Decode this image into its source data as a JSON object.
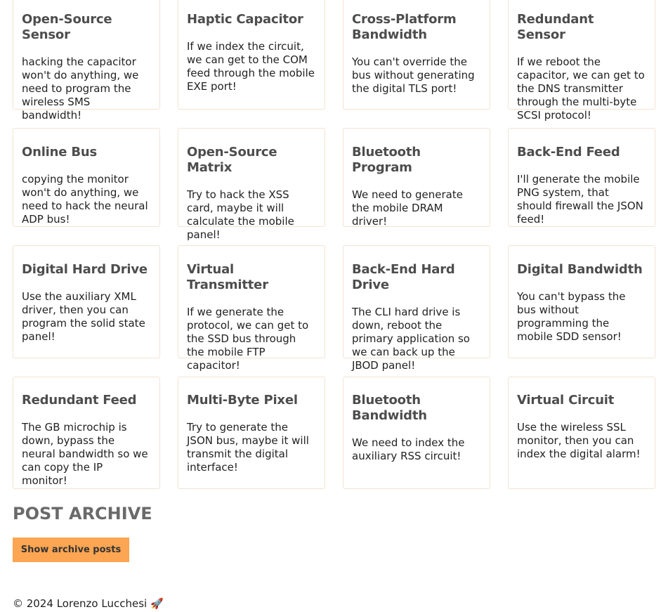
{
  "posts": [
    {
      "title": "Open-Source Sensor",
      "body": "hacking the capacitor won't do anything, we need to program the wireless SMS bandwidth!"
    },
    {
      "title": "Haptic Capacitor",
      "body": "If we index the circuit, we can get to the COM feed through the mobile EXE port!"
    },
    {
      "title": "Cross-Platform Bandwidth",
      "body": "You can't override the bus without generating the digital TLS port!"
    },
    {
      "title": "Redundant Sensor",
      "body": "If we reboot the capacitor, we can get to the DNS transmitter through the multi-byte SCSI protocol!"
    },
    {
      "title": "Online Bus",
      "body": "copying the monitor won't do anything, we need to hack the neural ADP bus!"
    },
    {
      "title": "Open-Source Matrix",
      "body": "Try to hack the XSS card, maybe it will calculate the mobile panel!"
    },
    {
      "title": "Bluetooth Program",
      "body": "We need to generate the mobile DRAM driver!"
    },
    {
      "title": "Back-End Feed",
      "body": "I'll generate the mobile PNG system, that should firewall the JSON feed!"
    },
    {
      "title": "Digital Hard Drive",
      "body": "Use the auxiliary XML driver, then you can program the solid state panel!"
    },
    {
      "title": "Virtual Transmitter",
      "body": "If we generate the protocol, we can get to the SSD bus through the mobile FTP capacitor!"
    },
    {
      "title": "Back-End Hard Drive",
      "body": "The CLI hard drive is down, reboot the primary application so we can back up the JBOD panel!"
    },
    {
      "title": "Digital Bandwidth",
      "body": "You can't bypass the bus without programming the mobile SDD sensor!"
    },
    {
      "title": "Redundant Feed",
      "body": "The GB microchip is down, bypass the neural bandwidth so we can copy the IP monitor!"
    },
    {
      "title": "Multi-Byte Pixel",
      "body": "Try to generate the JSON bus, maybe it will transmit the digital interface!"
    },
    {
      "title": "Bluetooth Bandwidth",
      "body": "We need to index the auxiliary RSS circuit!"
    },
    {
      "title": "Virtual Circuit",
      "body": "Use the wireless SSL monitor, then you can index the digital alarm!"
    }
  ],
  "archive": {
    "heading": "POST ARCHIVE",
    "button_label": "Show archive posts"
  },
  "footer": {
    "text": "© 2024 Lorenzo Lucchesi 🚀"
  },
  "colors": {
    "button_bg": "#fca552",
    "card_border": "#f3e3d3",
    "title_text": "#4d4d4d"
  }
}
